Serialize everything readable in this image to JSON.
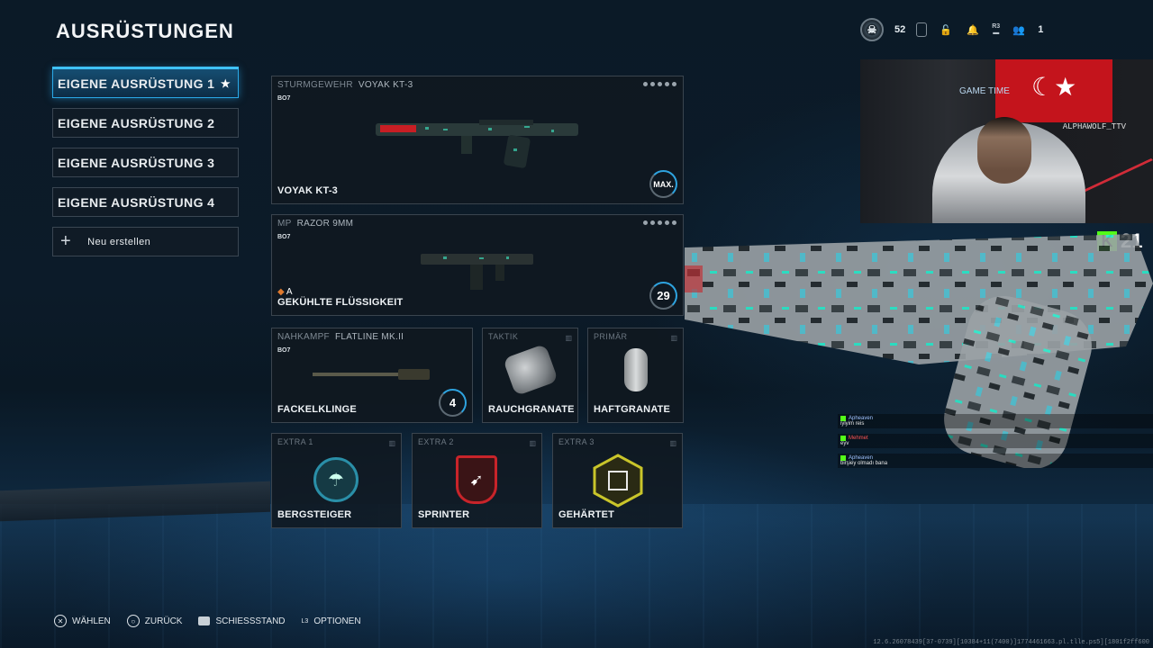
{
  "page_title": "AUSRÜSTUNGEN",
  "loadouts": [
    {
      "label": "EIGENE AUSRÜSTUNG 1",
      "favorite": "★"
    },
    {
      "label": "EIGENE AUSRÜSTUNG 2"
    },
    {
      "label": "EIGENE AUSRÜSTUNG 3"
    },
    {
      "label": "EIGENE AUSRÜSTUNG 4"
    }
  ],
  "new_loadout": {
    "icon": "+",
    "label": "Neu erstellen"
  },
  "primary": {
    "category": "STURMGEWEHR",
    "weapon": "VOYAK KT-3",
    "code": "BO7",
    "name": "VOYAK KT-3",
    "level": "MAX."
  },
  "secondary": {
    "category": "MP",
    "weapon": "RAZOR 9MM",
    "code": "BO7",
    "name": "GEKÜHLTE FLÜSSIGKEIT",
    "level": "29"
  },
  "melee": {
    "category": "NAHKAMPF",
    "weapon": "FLATLINE MK.II",
    "code": "BO7",
    "name": "FACKELKLINGE",
    "level": "4"
  },
  "tactical": {
    "category": "TAKTIK",
    "name": "RAUCHGRANATE"
  },
  "lethal": {
    "category": "PRIMÄR",
    "name": "HAFTGRANATE"
  },
  "perks": [
    {
      "slot": "EXTRA 1",
      "name": "BERGSTEIGER",
      "color": "#2a8fa8"
    },
    {
      "slot": "EXTRA 2",
      "name": "SPRINTER",
      "color": "#c8242a"
    },
    {
      "slot": "EXTRA 3",
      "name": "GEHÄRTET",
      "color": "#c9c52a"
    }
  ],
  "topbar": {
    "rank": "52",
    "party_count": "1",
    "r3": "R3"
  },
  "stream": {
    "kick_count": "21",
    "overlay_text": "GAME TIME",
    "handle": "ALPHAWOLF_TTV",
    "chat": [
      {
        "user": "Apheaven",
        "text": "iyiyim reis"
      },
      {
        "user": "Mehmet",
        "text": "eyv"
      },
      {
        "user": "Apheaven",
        "text": "birşiey olmadı bana"
      }
    ]
  },
  "footer": [
    {
      "icon": "✕",
      "label": "WÄHLEN"
    },
    {
      "icon": "○",
      "label": "ZURÜCK"
    },
    {
      "icon": "",
      "label": "SCHIESSSTAND"
    },
    {
      "icon": "L3",
      "label": "OPTIONEN"
    }
  ],
  "debug_text": "12.6.26078439[37-0739][10384+11(7400)]1774461663.pl.tlle.ps5][1801f2ff600",
  "colors": {
    "accent": "#2aa9e8",
    "kick": "#53fc18"
  }
}
